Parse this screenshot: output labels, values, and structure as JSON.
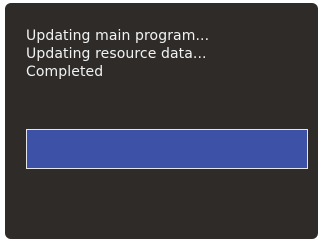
{
  "status_log": {
    "lines": [
      "Updating main program...",
      "Updating resource data...",
      "Completed"
    ]
  },
  "progress": {
    "fraction": 1.0,
    "fill_color": "#3d52a6",
    "border_color": "#e6e6e6"
  },
  "colors": {
    "screen_background": "#2e2b29",
    "text": "#f2f2f2"
  }
}
